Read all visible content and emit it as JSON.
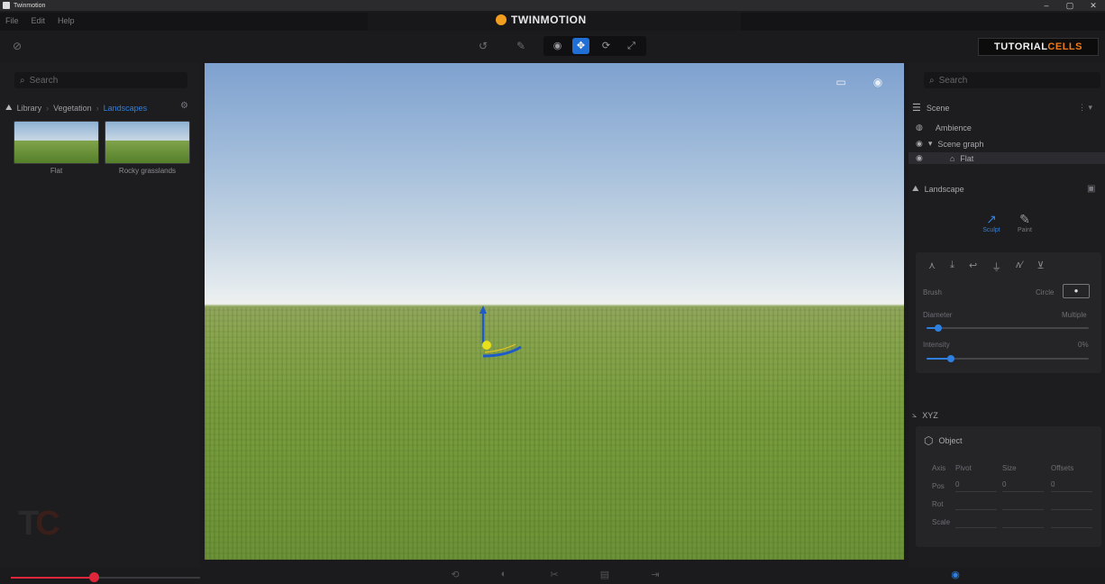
{
  "window": {
    "title": "Twinmotion",
    "controls": [
      "–",
      "▢",
      "✕"
    ]
  },
  "menu": [
    "File",
    "Edit",
    "Help"
  ],
  "brand": {
    "name": "TWINMOTION"
  },
  "watermark": {
    "part1": "TUTORIAL",
    "part2": "CELLS",
    "tc": "T",
    "tc2": "C"
  },
  "toolbar": {
    "left_icon": "check-circle-icon",
    "tools": [
      "select-icon",
      "move-icon",
      "rotate-icon",
      "scale-icon"
    ]
  },
  "library": {
    "search_placeholder": "Search",
    "breadcrumb": [
      "Library",
      "Vegetation",
      "Landscapes"
    ],
    "items": [
      {
        "label": "Flat"
      },
      {
        "label": "Rocky grasslands"
      }
    ]
  },
  "scene": {
    "search_placeholder": "Search",
    "title": "Scene",
    "items": [
      {
        "label": "Ambience"
      },
      {
        "label": "Scene graph"
      },
      {
        "label": "Flat"
      }
    ]
  },
  "landscape": {
    "title": "Landscape",
    "modes": [
      {
        "label": "Sculpt"
      },
      {
        "label": "Paint"
      }
    ],
    "brush_label": "Brush",
    "brush_mode": "Circle",
    "sliders": [
      {
        "label": "Diameter",
        "value": "Multiple",
        "fraction": 0.07
      },
      {
        "label": "Intensity",
        "value": "0%",
        "fraction": 0.15
      }
    ]
  },
  "xyz": {
    "title": "XYZ",
    "object_title": "Object",
    "headers": [
      "Axis",
      "Pivot",
      "Size",
      "Offsets"
    ],
    "rows": [
      {
        "label": "Pos",
        "values": [
          "0",
          "0",
          "0"
        ]
      },
      {
        "label": "Rot",
        "values": [
          "",
          "",
          ""
        ]
      },
      {
        "label": "Scale",
        "values": [
          "",
          "",
          ""
        ]
      }
    ]
  },
  "colors": {
    "accent": "#2f7fe0",
    "timeline": "#e0263a",
    "brand_orange": "#f29d1f"
  }
}
